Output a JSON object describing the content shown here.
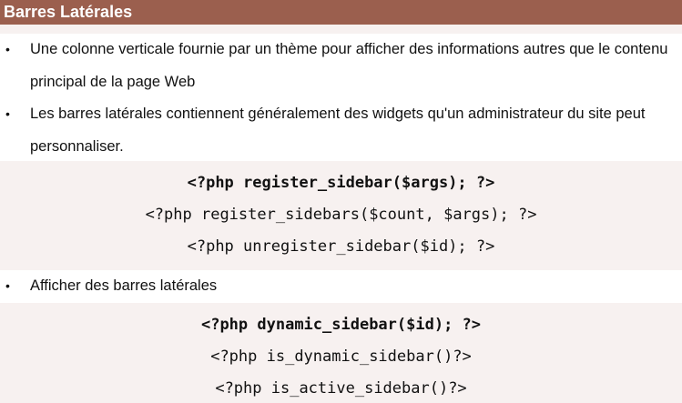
{
  "title": "Barres Latérales",
  "bullets_1": [
    "Une colonne verticale fournie par un thème pour afficher des informations autres que le contenu principal de la page Web",
    "Les barres latérales contiennent généralement des widgets qu'un administrateur du site peut personnaliser."
  ],
  "code_1": [
    "<?php register_sidebar($args); ?>",
    "<?php register_sidebars($count, $args); ?>",
    "<?php unregister_sidebar($id); ?>"
  ],
  "bullets_2": [
    "Afficher des barres latérales"
  ],
  "code_2": [
    "<?php dynamic_sidebar($id); ?>",
    "<?php is_dynamic_sidebar()?>",
    "<?php is_active_sidebar()?>"
  ],
  "bullet_glyph": "•",
  "colors": {
    "title_bar": "#9b5f4e",
    "title_text": "#ffffff",
    "code_background": "#f7f1f0",
    "text": "#111111"
  }
}
